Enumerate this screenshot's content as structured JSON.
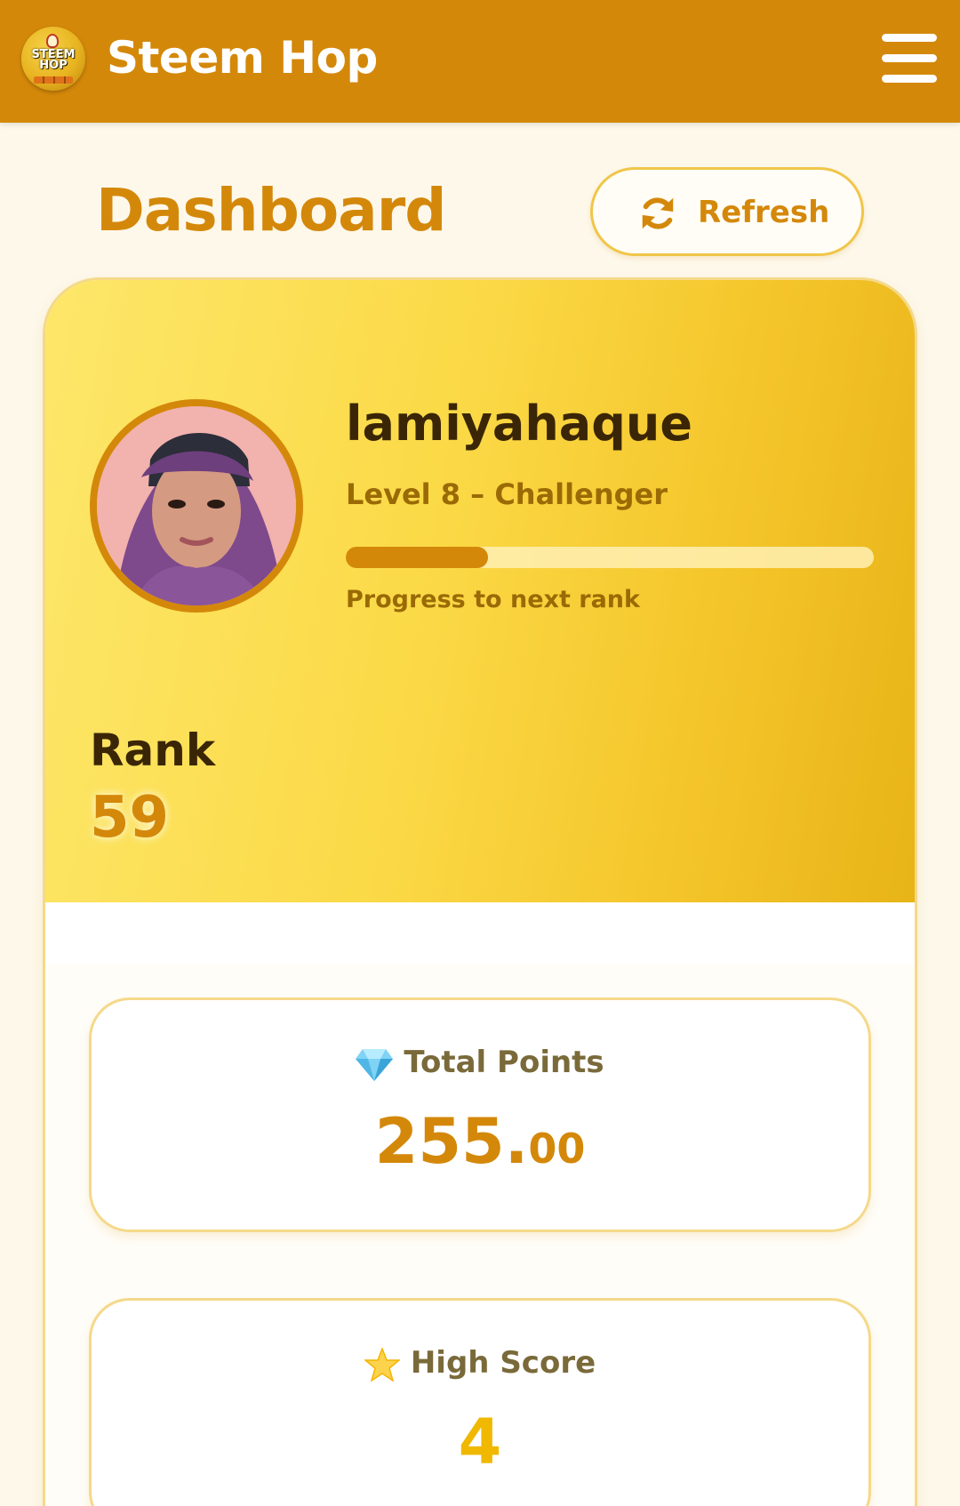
{
  "header": {
    "app_title": "Steem Hop",
    "logo_text": "STEEM HOP",
    "menu_icon": "hamburger-menu-icon",
    "brand_color": "#d4880a"
  },
  "dashboard": {
    "title": "Dashboard",
    "refresh_label": "Refresh",
    "refresh_icon": "refresh-icon"
  },
  "profile": {
    "username": "lamiyahaque",
    "level": "Level 8 – Challenger",
    "progress_fraction": 0.27,
    "progress_caption": "Progress to next rank",
    "rank_label": "Rank",
    "rank_value": "59"
  },
  "stats": [
    {
      "icon": "gem-icon",
      "label": "Total Points",
      "value_main": "255.",
      "value_decimals": "00"
    },
    {
      "icon": "star-icon",
      "label": "High Score",
      "value_main": "4",
      "value_decimals": ""
    }
  ]
}
